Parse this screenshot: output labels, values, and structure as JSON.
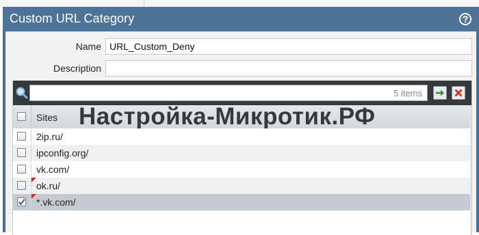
{
  "dialog": {
    "title": "Custom URL Category",
    "help_icon": "help-circle-icon"
  },
  "form": {
    "name_label": "Name",
    "name_value": "URL_Custom_Deny",
    "description_label": "Description",
    "description_value": ""
  },
  "grid": {
    "search_icon": "magnifier-icon",
    "search_value": "",
    "items_count": "5 items",
    "go_icon": "arrow-right-icon",
    "clear_icon": "clear-x-icon",
    "header": {
      "sites": "Sites"
    },
    "rows": [
      {
        "site": "2ip.ru/",
        "checked": false,
        "modified": false
      },
      {
        "site": "ipconfig.org/",
        "checked": false,
        "modified": false
      },
      {
        "site": "vk.com/",
        "checked": false,
        "modified": false
      },
      {
        "site": "ok.ru/",
        "checked": false,
        "modified": true
      },
      {
        "site": "*.vk.com/",
        "checked": true,
        "modified": true
      }
    ]
  },
  "watermark": "Настройка-Микротик.РФ",
  "colors": {
    "title_bar": "#4d7397",
    "toolbar": "#34393e",
    "selected_row": "#c5cbd1",
    "alt_row": "#eef0f2",
    "modified_marker": "#d9261c"
  }
}
